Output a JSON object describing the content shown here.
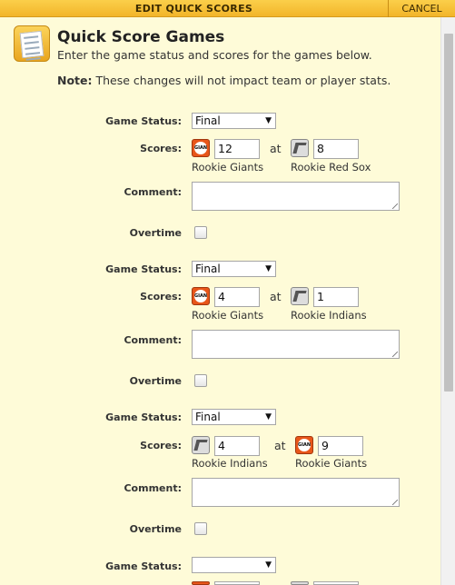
{
  "dialog": {
    "title": "EDIT QUICK SCORES",
    "cancel_label": "CANCEL",
    "heading": "Quick Score Games",
    "subtitle": "Enter the game status and scores for the games below.",
    "note_label": "Note:",
    "note_text": " These changes will not impact team or player stats."
  },
  "labels": {
    "status": "Game Status:",
    "scores": "Scores:",
    "comment": "Comment:",
    "overtime": "Overtime",
    "at": "at"
  },
  "icons": {
    "giants_text": "GIANTS"
  },
  "games": [
    {
      "status": "Final",
      "away_team": "Rookie Giants",
      "away_icon": "giants-logo-icon",
      "away_score": "12",
      "home_team": "Rookie Red Sox",
      "home_icon": "red-sox-logo-icon",
      "home_score": "8",
      "comment": "",
      "overtime": false
    },
    {
      "status": "Final",
      "away_team": "Rookie Giants",
      "away_icon": "giants-logo-icon",
      "away_score": "4",
      "home_team": "Rookie Indians",
      "home_icon": "indians-logo-icon",
      "home_score": "1",
      "comment": "",
      "overtime": false
    },
    {
      "status": "Final",
      "away_team": "Rookie Indians",
      "away_icon": "indians-logo-icon",
      "away_score": "4",
      "home_team": "Rookie Giants",
      "home_icon": "giants-logo-icon",
      "home_score": "9",
      "comment": "",
      "overtime": false
    },
    {
      "status": ""
    }
  ]
}
